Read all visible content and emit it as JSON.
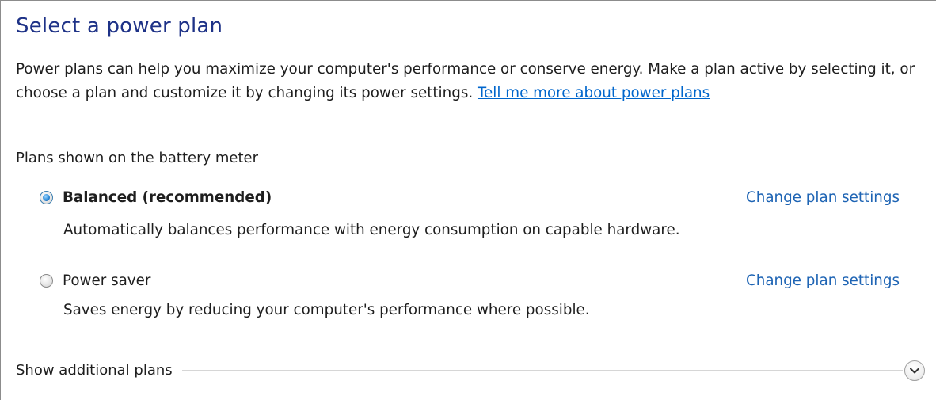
{
  "page": {
    "title": "Select a power plan",
    "intro_text": "Power plans can help you maximize your computer's performance or conserve energy. Make a plan active by selecting it, or choose a plan and customize it by changing its power settings. ",
    "intro_link": "Tell me more about power plans"
  },
  "plans_section": {
    "header": "Plans shown on the battery meter",
    "plans": [
      {
        "name": "Balanced (recommended)",
        "description": "Automatically balances performance with energy consumption on capable hardware.",
        "selected": true,
        "change_label": "Change plan settings"
      },
      {
        "name": "Power saver",
        "description": "Saves energy by reducing your computer's performance where possible.",
        "selected": false,
        "change_label": "Change plan settings"
      }
    ]
  },
  "additional": {
    "label": "Show additional plans",
    "icon": "chevron-down-icon"
  },
  "colors": {
    "title": "#1e3287",
    "link": "#0066cc",
    "change_link": "#1e64b4",
    "radio_selected": "#2b8ad8"
  }
}
